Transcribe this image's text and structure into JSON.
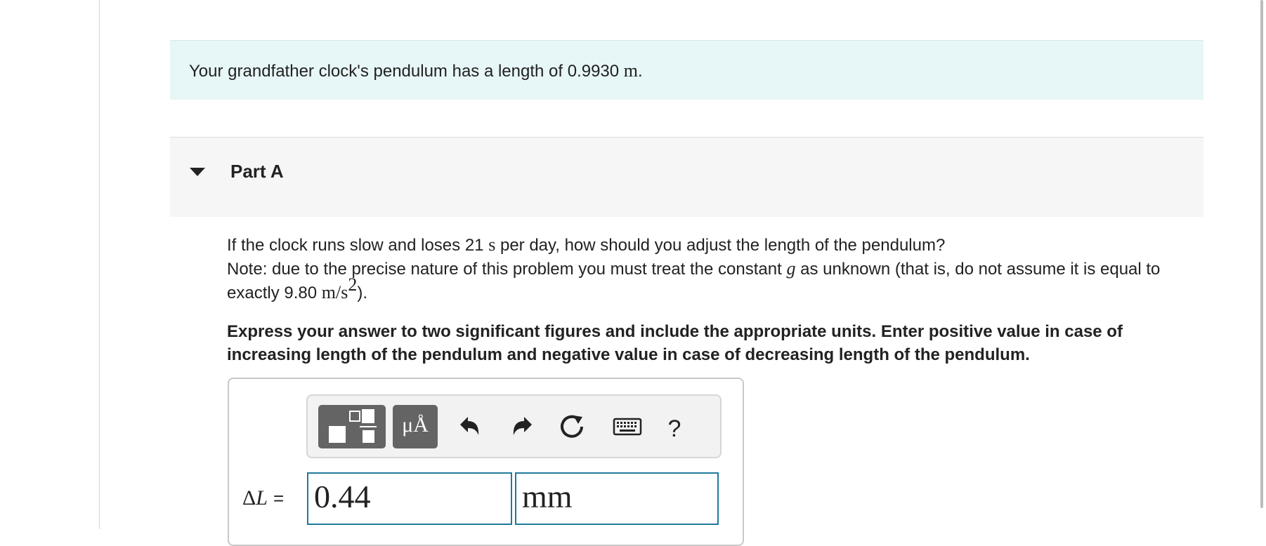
{
  "intro": {
    "text_before": "Your grandfather clock's pendulum has a length of 0.9930 ",
    "unit": "m",
    "text_after": "."
  },
  "part": {
    "title": "Part A",
    "expanded": true
  },
  "question": {
    "line1_a": "If the clock runs slow and loses 21 ",
    "line1_unit": "s",
    "line1_b": " per day, how should you adjust the length of the pendulum?",
    "line2_a": "Note: due to the precise nature of this problem you must treat the constant ",
    "line2_var": "g",
    "line2_b": " as unknown (that is, do not assume it is equal to exactly 9.80 ",
    "line2_unit_base": "m/s",
    "line2_unit_exp": "2",
    "line2_c": ")."
  },
  "instructions": "Express your answer to two significant figures and include the appropriate units. Enter positive value in case of increasing length of the pendulum and negative value in case of decreasing length of the pendulum.",
  "toolbar": {
    "templates_icon": "templates-icon",
    "units_label": "μÅ",
    "undo_icon": "undo-icon",
    "redo_icon": "redo-icon",
    "reset_icon": "reset-icon",
    "keyboard_icon": "keyboard-icon",
    "help_label": "?"
  },
  "answer": {
    "delta_symbol": "Δ",
    "variable": "L",
    "equals": "=",
    "value": "0.44",
    "unit": "mm"
  },
  "colors": {
    "intro_bg": "#e7f6f6",
    "part_bg": "#f6f6f6",
    "toolbar_btn": "#646464",
    "input_border": "#1f7a9a"
  }
}
